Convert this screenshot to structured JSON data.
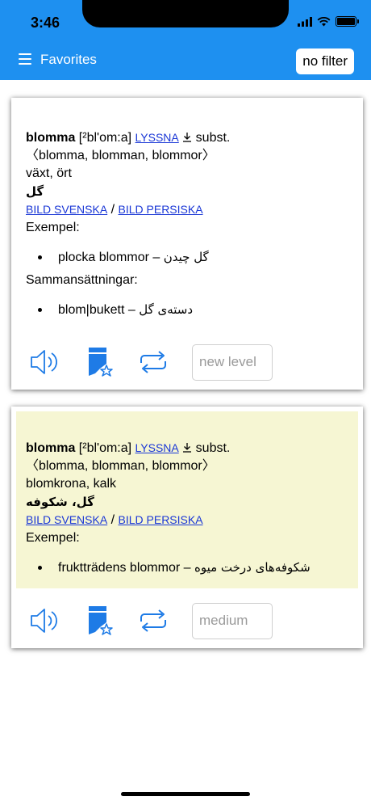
{
  "status_bar": {
    "time": "3:46"
  },
  "nav": {
    "title": "Favorites",
    "filter_label": "no filter"
  },
  "cards": [
    {
      "headword": "blomma",
      "pronunciation": "[²bl'om:a]",
      "listen_label": "LYSSNA",
      "word_class": "subst.",
      "inflections": "〈blomma, blomman, blommor〉",
      "definition": "växt, ört",
      "translation": "گل",
      "image_link_swedish": "BILD SVENSKA",
      "image_link_persian": "BILD PERSISKA",
      "examples_heading": "Exempel:",
      "examples": [
        {
          "swedish": "plocka blommor –",
          "persian": "گل چیدن"
        }
      ],
      "compounds_heading": "Sammansättningar:",
      "compounds": [
        {
          "swedish": "blom|bukett –",
          "persian": "دسته‌ی گل"
        }
      ],
      "level_placeholder": "new level",
      "highlighted": false
    },
    {
      "headword": "blomma",
      "pronunciation": "[²bl'om:a]",
      "listen_label": "LYSSNA",
      "word_class": "subst.",
      "inflections": "〈blomma, blomman, blommor〉",
      "definition": "blomkrona, kalk",
      "translation": "گل، شکوفه",
      "image_link_swedish": "BILD SVENSKA",
      "image_link_persian": "BILD PERSISKA",
      "examples_heading": "Exempel:",
      "examples": [
        {
          "swedish": "fruktträdens blommor –",
          "persian": "شکوفه‌های درخت میوه"
        }
      ],
      "level_placeholder": "medium",
      "highlighted": true
    }
  ],
  "colors": {
    "accent": "#1e90f0",
    "link": "#1a37d6",
    "highlight_bg": "#f6f6d3",
    "icon_blue": "#1e7be6"
  },
  "icons": {
    "menu": "hamburger-menu-icon",
    "download": "download-arrow-icon",
    "speaker": "speaker-icon",
    "bookmark": "bookmark-star-icon",
    "repeat": "repeat-icon"
  }
}
